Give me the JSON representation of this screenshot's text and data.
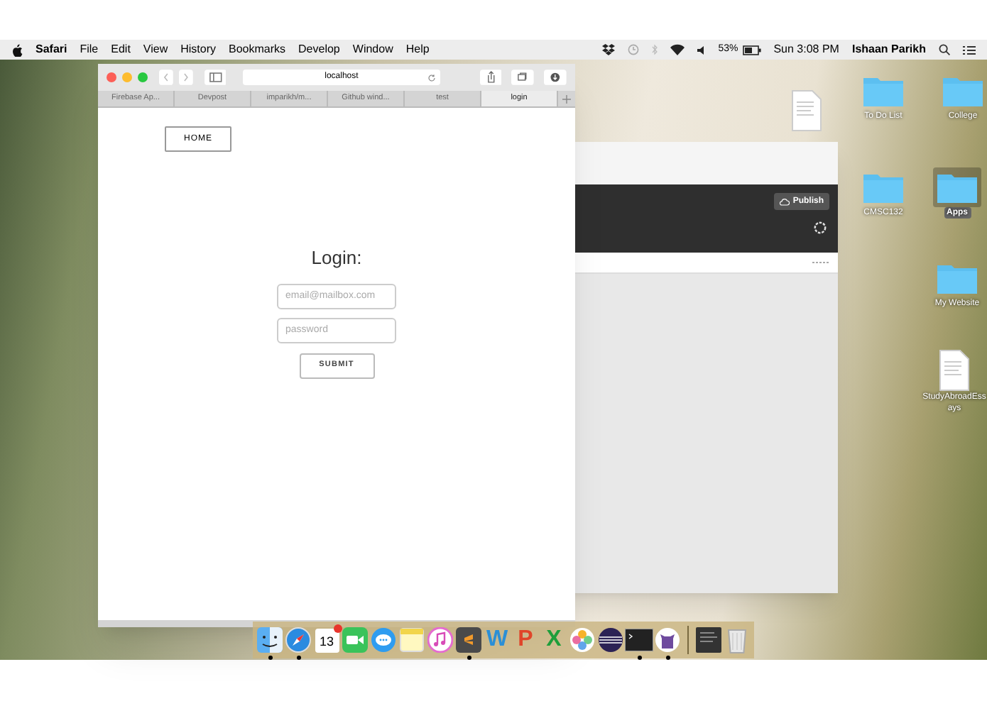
{
  "menu_bar": {
    "app_name": "Safari",
    "menus": [
      "File",
      "Edit",
      "View",
      "History",
      "Bookmarks",
      "Develop",
      "Window",
      "Help"
    ],
    "battery": "53%",
    "clock": "Sun 3:08 PM",
    "user": "Ishaan Parikh"
  },
  "safari": {
    "address": "localhost",
    "tabs": [
      {
        "label": "Firebase Ap...",
        "selected": false
      },
      {
        "label": "Devpost",
        "selected": false
      },
      {
        "label": "imparikh/m...",
        "selected": false
      },
      {
        "label": "Github wind...",
        "selected": false
      },
      {
        "label": "test",
        "selected": false
      },
      {
        "label": "login",
        "selected": true
      }
    ],
    "page": {
      "home_button": "HOME",
      "heading": "Login:",
      "email_placeholder": "email@mailbox.com",
      "password_placeholder": "password",
      "submit_button": "SUBMIT"
    }
  },
  "editor_window": {
    "publish_button": "Publish"
  },
  "desktop_icons": [
    {
      "kind": "docx",
      "selected": false
    },
    {
      "kind": "folder",
      "label": "To Do List",
      "selected": false
    },
    {
      "kind": "folder",
      "label": "College",
      "selected": false
    },
    {
      "kind": "folder",
      "label": "CMSC132",
      "selected": false
    },
    {
      "kind": "folder",
      "label": "Apps",
      "selected": true
    },
    {
      "kind": "folder",
      "label": "My Website",
      "selected": false
    },
    {
      "kind": "docx",
      "label": "StudyAbroadEss ays",
      "selected": false
    }
  ],
  "dock": [
    {
      "kind": "finder",
      "running": true
    },
    {
      "kind": "safari",
      "running": true
    },
    {
      "kind": "calendar",
      "text": "13",
      "running": false
    },
    {
      "kind": "facetime",
      "running": false
    },
    {
      "kind": "messages",
      "running": false
    },
    {
      "kind": "notes",
      "running": false
    },
    {
      "kind": "itunes",
      "running": false
    },
    {
      "kind": "sublime",
      "running": true
    },
    {
      "kind": "letter",
      "text": "W",
      "color": "#2b8fd6",
      "running": false
    },
    {
      "kind": "letter",
      "text": "P",
      "color": "#e0452a",
      "running": false
    },
    {
      "kind": "letter",
      "text": "X",
      "color": "#1e9e3a",
      "running": false
    },
    {
      "kind": "photos",
      "running": false
    },
    {
      "kind": "eclipse",
      "running": false
    },
    {
      "kind": "terminal",
      "running": true
    },
    {
      "kind": "github",
      "running": true
    },
    {
      "kind": "separator"
    },
    {
      "kind": "document",
      "running": false
    },
    {
      "kind": "trash",
      "running": false
    }
  ]
}
